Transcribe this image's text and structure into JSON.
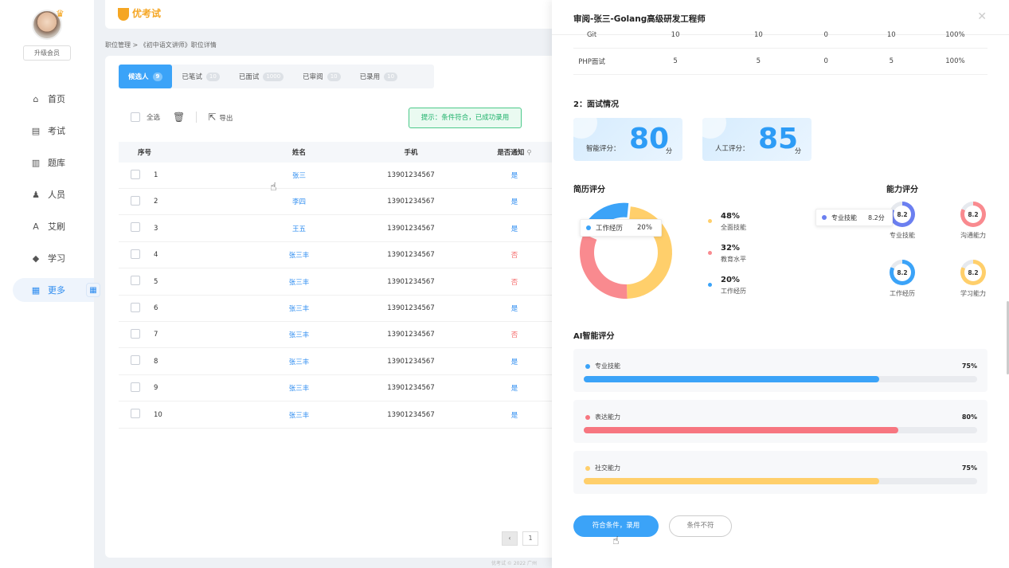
{
  "sidebar": {
    "upgrade_label": "升级会员",
    "items": [
      {
        "icon": "home-icon",
        "glyph": "⌂",
        "label": "首页"
      },
      {
        "icon": "exam-icon",
        "glyph": "▤",
        "label": "考试"
      },
      {
        "icon": "question-bank-icon",
        "glyph": "▥",
        "label": "题库"
      },
      {
        "icon": "people-icon",
        "glyph": "♟",
        "label": "人员"
      },
      {
        "icon": "brush-icon",
        "glyph": "A",
        "label": "艾刷"
      },
      {
        "icon": "study-icon",
        "glyph": "◆",
        "label": "学习"
      },
      {
        "icon": "more-icon",
        "glyph": "▦",
        "label": "更多"
      }
    ]
  },
  "header": {
    "logo_text": "优考试"
  },
  "breadcrumb": "职位管理 > 《初中语文讲师》职位详情",
  "tabs": [
    {
      "label": "候选人",
      "count": "9"
    },
    {
      "label": "已笔试",
      "count": "10"
    },
    {
      "label": "已面试",
      "count": "1000"
    },
    {
      "label": "已审阅",
      "count": "10"
    },
    {
      "label": "已录用",
      "count": "10"
    }
  ],
  "toolbar": {
    "select_all": "全选",
    "export": "导出"
  },
  "tip": "提示：条件符合，已成功录用",
  "table": {
    "headers": [
      "序号",
      "姓名",
      "手机",
      "是否通知"
    ],
    "rows": [
      {
        "no": "1",
        "name": "张三",
        "phone": "13901234567",
        "notify": "是"
      },
      {
        "no": "2",
        "name": "李四",
        "phone": "13901234567",
        "notify": "是"
      },
      {
        "no": "3",
        "name": "王五",
        "phone": "13901234567",
        "notify": "是"
      },
      {
        "no": "4",
        "name": "张三丰",
        "phone": "13901234567",
        "notify": "否"
      },
      {
        "no": "5",
        "name": "张三丰",
        "phone": "13901234567",
        "notify": "否"
      },
      {
        "no": "6",
        "name": "张三丰",
        "phone": "13901234567",
        "notify": "是"
      },
      {
        "no": "7",
        "name": "张三丰",
        "phone": "13901234567",
        "notify": "否"
      },
      {
        "no": "8",
        "name": "张三丰",
        "phone": "13901234567",
        "notify": "是"
      },
      {
        "no": "9",
        "name": "张三丰",
        "phone": "13901234567",
        "notify": "是"
      },
      {
        "no": "10",
        "name": "张三丰",
        "phone": "13901234567",
        "notify": "是"
      }
    ]
  },
  "pager": {
    "current": "1"
  },
  "footer": "优考试 © 2022 广州",
  "drawer": {
    "title": "审阅-张三-Golang高级研发工程师",
    "skill_rows": [
      [
        "Git",
        "10",
        "10",
        "0",
        "10",
        "100%"
      ],
      [
        "PHP面试",
        "5",
        "5",
        "0",
        "5",
        "100%"
      ]
    ],
    "interview_title": "2：面试情况",
    "ai_score_label": "智能评分：",
    "ai_score": "80",
    "manual_score_label": "人工评分：",
    "manual_score": "85",
    "score_unit": "分",
    "resume_title": "简历评分",
    "ability_title": "能力评分",
    "donut_tip": {
      "label": "工作经历",
      "value": "20%"
    },
    "skill_tip": {
      "label": "专业技能",
      "value": "8.2分"
    },
    "ai_title": "AI智能评分",
    "accept_button": "符合条件，录用",
    "reject_button": "条件不符"
  },
  "chart_data": [
    {
      "type": "pie",
      "title": "简历评分",
      "slices": [
        {
          "name": "全面技能",
          "value": 48,
          "label": "48%",
          "color": "#ffcf6b"
        },
        {
          "name": "教育水平",
          "value": 32,
          "label": "32%",
          "color": "#f98a8f"
        },
        {
          "name": "工作经历",
          "value": 20,
          "label": "20%",
          "color": "#3ba3f8"
        }
      ]
    },
    {
      "type": "pie",
      "title": "能力评分",
      "rings": [
        {
          "name": "专业技能",
          "value": 8.2,
          "label": "8.2",
          "color": "#6b7ff0"
        },
        {
          "name": "沟通能力",
          "value": 8.2,
          "label": "8.2",
          "color": "#f98a8f"
        },
        {
          "name": "工作经历",
          "value": 8.2,
          "label": "8.2",
          "color": "#3ba3f8"
        },
        {
          "name": "学习能力",
          "value": 8.2,
          "label": "8.2",
          "color": "#ffcf6b"
        }
      ]
    },
    {
      "type": "bar",
      "title": "AI智能评分",
      "bars": [
        {
          "name": "专业技能",
          "value": 75,
          "label": "75%",
          "color": "#3ba3f8"
        },
        {
          "name": "表达能力",
          "value": 80,
          "label": "80%",
          "color": "#f77680"
        },
        {
          "name": "社交能力",
          "value": 75,
          "label": "75%",
          "color": "#ffcf6b"
        }
      ]
    }
  ]
}
